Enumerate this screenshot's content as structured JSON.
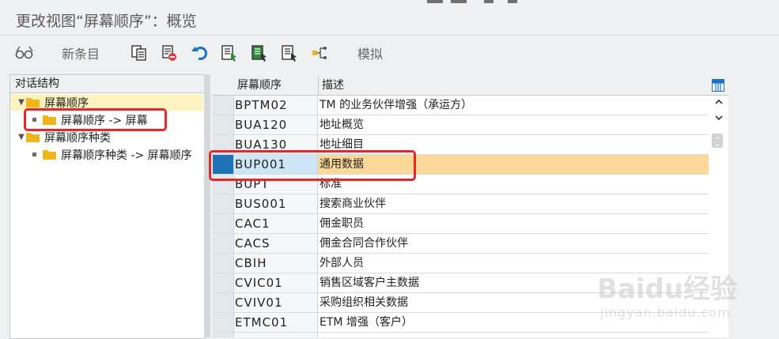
{
  "window": {
    "title": "更改视图“屏幕顺序”：概览"
  },
  "toolbar": {
    "new_entries_label": "新条目",
    "simulate_label": "模拟"
  },
  "icons": {
    "glasses": "display-change-icon",
    "copy": "copy-as-icon",
    "delete": "delete-icon",
    "undo": "undo-icon",
    "select_all": "select-all-icon",
    "select_block": "select-block-icon",
    "deselect_all": "deselect-all-icon",
    "navigate": "navigate-icon",
    "grid": "table-settings-icon"
  },
  "dialog_structure": {
    "heading": "对话结构",
    "items": [
      {
        "label": "屏幕顺序",
        "level": 0,
        "expanded": true
      },
      {
        "label": "屏幕顺序 -> 屏幕",
        "level": 1
      },
      {
        "label": "屏幕顺序种类",
        "level": 0,
        "expanded": true
      },
      {
        "label": "屏幕顺序种类 -> 屏幕顺序",
        "level": 1
      }
    ]
  },
  "table": {
    "columns": [
      "屏幕顺序",
      "描述"
    ],
    "rows": [
      {
        "code": "BPTM02",
        "desc": "TM 的业务伙伴增强（承运方）"
      },
      {
        "code": "BUA120",
        "desc": "地址概览"
      },
      {
        "code": "BUA130",
        "desc": "地址细目"
      },
      {
        "code": "BUP001",
        "desc": "通用数据",
        "selected": true
      },
      {
        "code": "BUPT",
        "desc": "标准"
      },
      {
        "code": "BUS001",
        "desc": "搜索商业伙伴"
      },
      {
        "code": "CAC1",
        "desc": "佣金职员"
      },
      {
        "code": "CACS",
        "desc": "佣金合同合作伙伴"
      },
      {
        "code": "CBIH",
        "desc": "外部人员"
      },
      {
        "code": "CVIC01",
        "desc": "销售区域客户主数据"
      },
      {
        "code": "CVIV01",
        "desc": "采购组织相关数据"
      },
      {
        "code": "ETMC01",
        "desc": "ETM 增强（客户）"
      },
      {
        "code": "",
        "desc": ""
      }
    ]
  },
  "watermark": {
    "logo": "Baidu经验",
    "url": "jingyan.baidu.com"
  },
  "colors": {
    "selection_blue": "#1f72b8",
    "row_highlight": "#fcd898",
    "annotation_red": "#e8262a",
    "folder": "#f0b41c"
  }
}
